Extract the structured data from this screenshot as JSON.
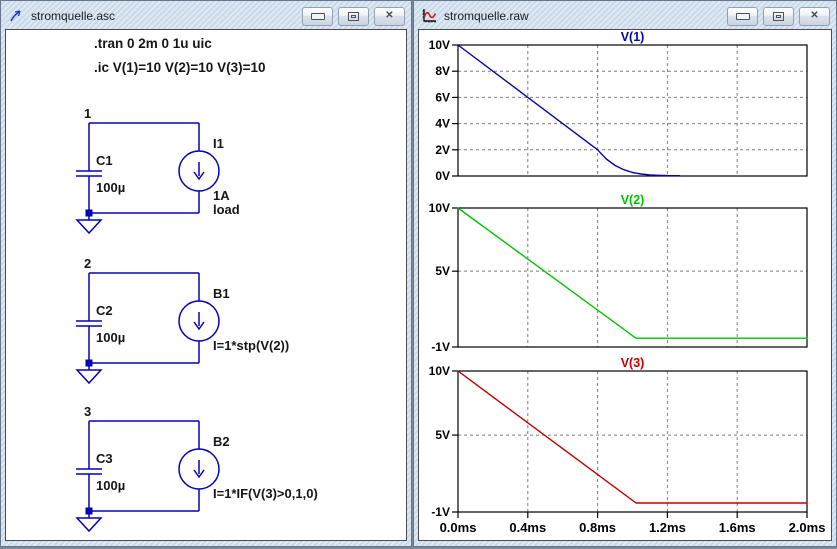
{
  "windows": {
    "schematic": {
      "title": "stromquelle.asc"
    },
    "plot": {
      "title": "stromquelle.raw"
    },
    "chrome": {
      "close_glyph": "✕"
    }
  },
  "schematic": {
    "wire_color": "#0202b8",
    "directives": [
      ".tran 0 2m 0 1u uic",
      ".ic V(1)=10 V(2)=10 V(3)=10"
    ],
    "circuits": [
      {
        "node": "1",
        "cap_name": "C1",
        "cap_value": "100µ",
        "src_name": "I1",
        "src_value": "1A",
        "src_extra": "load"
      },
      {
        "node": "2",
        "cap_name": "C2",
        "cap_value": "100µ",
        "src_name": "B1",
        "src_value": "I=1*stp(V(2))",
        "src_extra": ""
      },
      {
        "node": "3",
        "cap_name": "C3",
        "cap_value": "100µ",
        "src_name": "B2",
        "src_value": "I=1*IF(V(3)>0,1,0)",
        "src_extra": ""
      }
    ]
  },
  "chart_data": {
    "type": "line",
    "x": {
      "range": [
        0,
        2
      ],
      "unit": "ms",
      "ticks": [
        0,
        0.4,
        0.8,
        1.2,
        1.6,
        2.0
      ],
      "tick_labels": [
        "0.0ms",
        "0.4ms",
        "0.8ms",
        "1.2ms",
        "1.6ms",
        "2.0ms"
      ]
    },
    "grid": "dashed",
    "panels": [
      {
        "title": "V(1)",
        "color": "#0404b0",
        "ylim": [
          0,
          10
        ],
        "yticks": [
          {
            "v": 0,
            "label": "0V"
          },
          {
            "v": 2,
            "label": "2V"
          },
          {
            "v": 4,
            "label": "4V"
          },
          {
            "v": 6,
            "label": "6V"
          },
          {
            "v": 8,
            "label": "8V"
          },
          {
            "v": 10,
            "label": "10V"
          }
        ],
        "points": [
          [
            0,
            10
          ],
          [
            0.8,
            2
          ],
          [
            0.85,
            1.3
          ],
          [
            0.9,
            0.8
          ],
          [
            0.95,
            0.48
          ],
          [
            1.0,
            0.27
          ],
          [
            1.05,
            0.15
          ],
          [
            1.1,
            0.08
          ],
          [
            1.15,
            0.05
          ],
          [
            1.2,
            0.03
          ],
          [
            1.27,
            0.02
          ]
        ]
      },
      {
        "title": "V(2)",
        "color": "#00c400",
        "ylim": [
          -1,
          10
        ],
        "yticks": [
          {
            "v": -1,
            "label": "-1V"
          },
          {
            "v": 5,
            "label": "5V"
          },
          {
            "v": 10,
            "label": "10V"
          }
        ],
        "points": [
          [
            0,
            10
          ],
          [
            1.02,
            -0.3
          ],
          [
            2,
            -0.3
          ]
        ]
      },
      {
        "title": "V(3)",
        "color": "#c40000",
        "ylim": [
          -1,
          10
        ],
        "yticks": [
          {
            "v": -1,
            "label": "-1V"
          },
          {
            "v": 5,
            "label": "5V"
          },
          {
            "v": 10,
            "label": "10V"
          }
        ],
        "points": [
          [
            0,
            10
          ],
          [
            1.02,
            -0.3
          ],
          [
            2,
            -0.3
          ]
        ]
      }
    ]
  }
}
